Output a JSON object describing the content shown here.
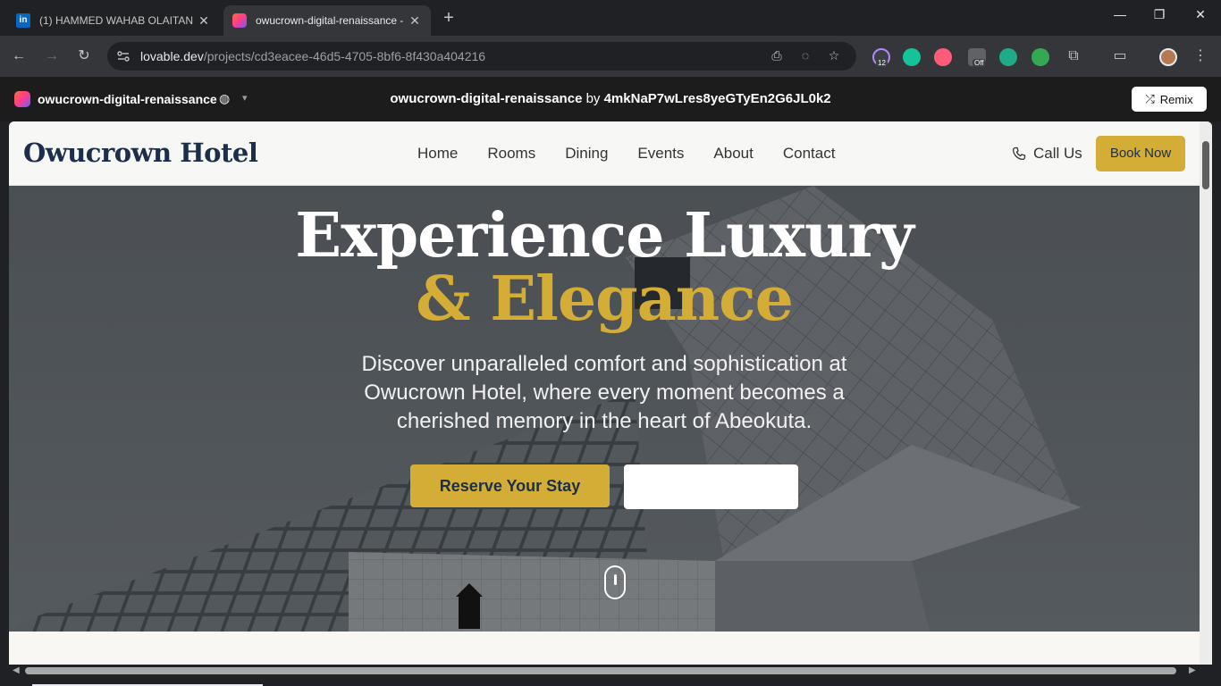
{
  "browser": {
    "tabs": [
      {
        "title": "(1) HAMMED WAHAB OLAITAN",
        "favicon": "linkedin-icon",
        "active": false
      },
      {
        "title": "owucrown-digital-renaissance -",
        "favicon": "lovable-icon",
        "active": true
      }
    ],
    "url_host": "lovable.dev",
    "url_path": "/projects/cd3eacee-46d5-4705-8bf6-8f430a404216",
    "extension_badges": {
      "ext1": "12",
      "ext2": "Off"
    }
  },
  "lovable_bar": {
    "project_name": "owucrown-digital-renaissance",
    "center_project": "owucrown-digital-renaissance",
    "center_by": "by",
    "center_owner": "4mkNaP7wLres8yeGTyEn2G6JL0k2",
    "remix_label": "Remix"
  },
  "site": {
    "brand": "Owucrown Hotel",
    "nav": [
      "Home",
      "Rooms",
      "Dining",
      "Events",
      "About",
      "Contact"
    ],
    "call_label": "Call Us",
    "book_label": "Book Now",
    "accent_color": "#d4ad37",
    "brand_color": "#1c2e4a"
  },
  "hero": {
    "title_line1": "Experience Luxury",
    "title_line2": "& Elegance",
    "subtitle": "Discover unparalleled comfort and sophistication at Owucrown Hotel, where every moment becomes a cherished memory in the heart of Abeokuta.",
    "reserve_label": "Reserve Your Stay",
    "secondary_label": ""
  }
}
